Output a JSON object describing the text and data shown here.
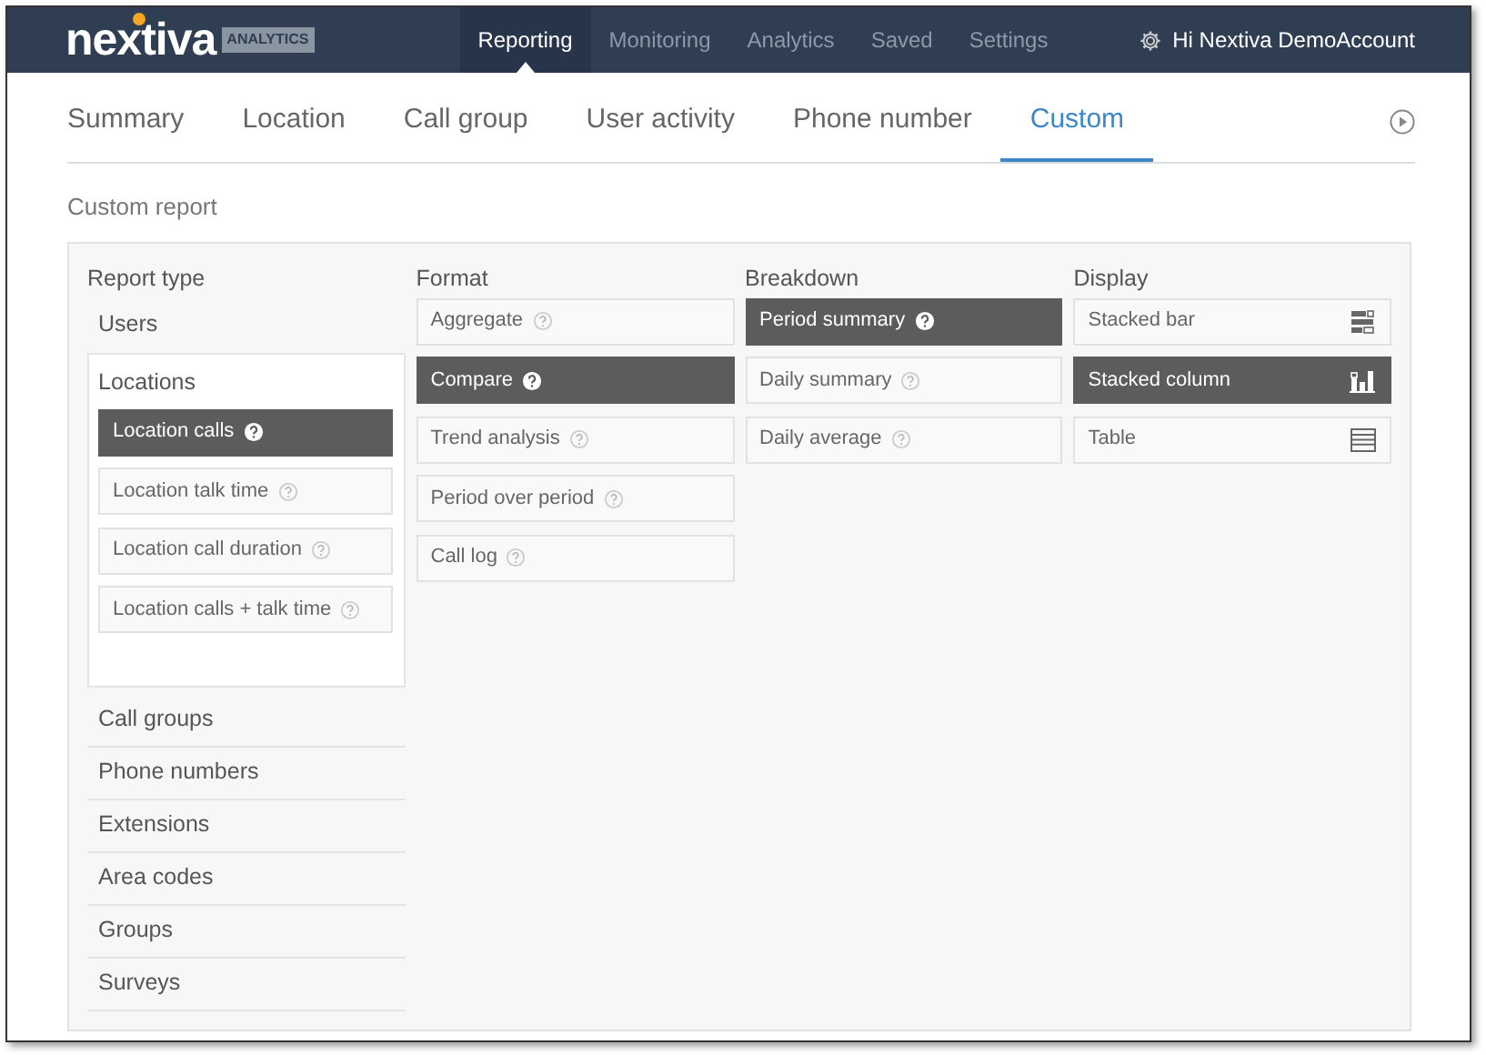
{
  "brand": {
    "name": "nextiva",
    "tag": "ANALYTICS"
  },
  "nav": [
    {
      "label": "Reporting",
      "selected": true
    },
    {
      "label": "Monitoring",
      "selected": false
    },
    {
      "label": "Analytics",
      "selected": false
    },
    {
      "label": "Saved",
      "selected": false
    },
    {
      "label": "Settings",
      "selected": false
    }
  ],
  "user": "Hi Nextiva DemoAccount",
  "tabs": [
    {
      "label": "Summary",
      "selected": false
    },
    {
      "label": "Location",
      "selected": false
    },
    {
      "label": "Call group",
      "selected": false
    },
    {
      "label": "User activity",
      "selected": false
    },
    {
      "label": "Phone number",
      "selected": false
    },
    {
      "label": "Custom",
      "selected": true
    }
  ],
  "section_title": "Custom report",
  "report_type": {
    "title": "Report type",
    "items": [
      {
        "label": "Users",
        "expanded": false
      },
      {
        "label": "Locations",
        "expanded": true,
        "children": [
          {
            "label": "Location calls",
            "selected": true
          },
          {
            "label": "Location talk time",
            "selected": false
          },
          {
            "label": "Location call duration",
            "selected": false
          },
          {
            "label": "Location calls + talk time",
            "selected": false
          }
        ]
      },
      {
        "label": "Call groups",
        "expanded": false
      },
      {
        "label": "Phone numbers",
        "expanded": false
      },
      {
        "label": "Extensions",
        "expanded": false
      },
      {
        "label": "Area codes",
        "expanded": false
      },
      {
        "label": "Groups",
        "expanded": false
      },
      {
        "label": "Surveys",
        "expanded": false
      }
    ]
  },
  "format": {
    "title": "Format",
    "options": [
      {
        "label": "Aggregate",
        "selected": false
      },
      {
        "label": "Compare",
        "selected": true
      },
      {
        "label": "Trend analysis",
        "selected": false
      },
      {
        "label": "Period over period",
        "selected": false
      },
      {
        "label": "Call log",
        "selected": false
      }
    ]
  },
  "breakdown": {
    "title": "Breakdown",
    "options": [
      {
        "label": "Period summary",
        "selected": true
      },
      {
        "label": "Daily summary",
        "selected": false
      },
      {
        "label": "Daily average",
        "selected": false
      }
    ]
  },
  "display": {
    "title": "Display",
    "options": [
      {
        "label": "Stacked bar",
        "selected": false,
        "kind": "bar"
      },
      {
        "label": "Stacked column",
        "selected": true,
        "kind": "column"
      },
      {
        "label": "Table",
        "selected": false,
        "kind": "table"
      }
    ]
  }
}
